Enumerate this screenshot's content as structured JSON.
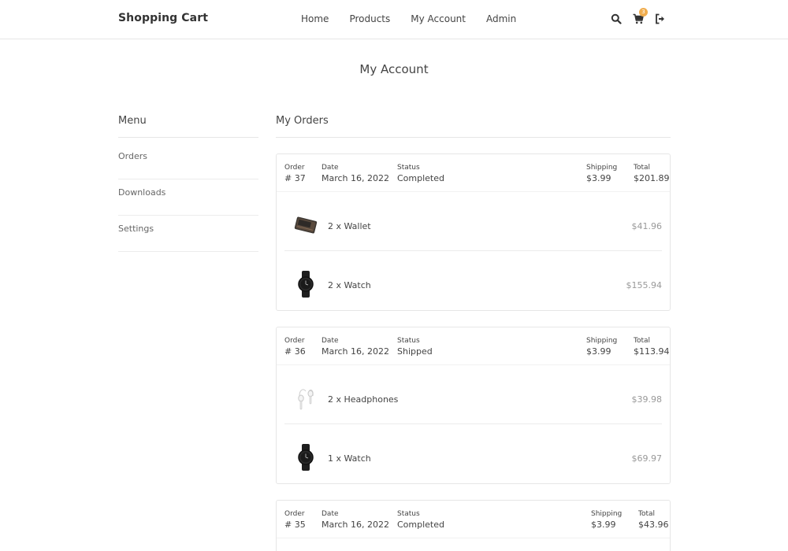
{
  "header": {
    "brand": "Shopping Cart",
    "nav": [
      "Home",
      "Products",
      "My Account",
      "Admin"
    ],
    "cart_count": "3",
    "icons": [
      "search-icon",
      "cart-icon",
      "logout-icon"
    ]
  },
  "page": {
    "title": "My Account"
  },
  "menu": {
    "heading": "Menu",
    "items": [
      "Orders",
      "Downloads",
      "Settings"
    ]
  },
  "orders_section": {
    "heading": "My Orders",
    "labels": {
      "order": "Order",
      "date": "Date",
      "status": "Status",
      "shipping": "Shipping",
      "total": "Total"
    },
    "orders": [
      {
        "number": "# 37",
        "date": "March 16, 2022",
        "status": "Completed",
        "shipping": "$3.99",
        "total": "$201.89",
        "items": [
          {
            "name": "2 x Wallet",
            "price": "$41.96",
            "thumb": "wallet"
          },
          {
            "name": "2 x Watch",
            "price": "$155.94",
            "thumb": "watch"
          }
        ]
      },
      {
        "number": "# 36",
        "date": "March 16, 2022",
        "status": "Shipped",
        "shipping": "$3.99",
        "total": "$113.94",
        "items": [
          {
            "name": "2 x Headphones",
            "price": "$39.98",
            "thumb": "headphones"
          },
          {
            "name": "1 x Watch",
            "price": "$69.97",
            "thumb": "watch"
          }
        ]
      },
      {
        "number": "# 35",
        "date": "March 16, 2022",
        "status": "Completed",
        "shipping": "$3.99",
        "total": "$43.96",
        "items": []
      }
    ]
  },
  "colors": {
    "badge": "#f0ad4e",
    "border": "#e6e6e6",
    "price": "#999999"
  }
}
